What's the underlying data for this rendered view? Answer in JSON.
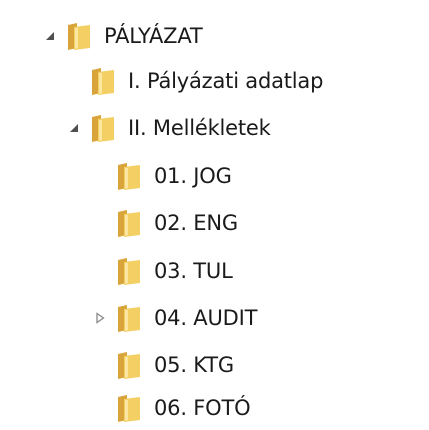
{
  "tree": {
    "items": [
      {
        "label": "PÁLYÁZAT",
        "state": "expanded"
      },
      {
        "label": "I. Pályázati adatlap",
        "state": "leaf"
      },
      {
        "label": "II. Mellékletek",
        "state": "expanded"
      },
      {
        "label": "01. JOG",
        "state": "leaf"
      },
      {
        "label": "02. ENG",
        "state": "leaf"
      },
      {
        "label": "03. TUL",
        "state": "leaf"
      },
      {
        "label": "04. AUDIT",
        "state": "collapsed"
      },
      {
        "label": "05. KTG",
        "state": "leaf"
      },
      {
        "label": "06. FOTÓ",
        "state": "leaf"
      }
    ]
  },
  "icons": {
    "folder": "folder-icon",
    "expanded": "expanded-triangle-icon",
    "collapsed": "collapsed-triangle-icon"
  },
  "colors": {
    "folder_back": "#d9a43a",
    "folder_front": "#f4cf63",
    "folder_highlight": "#fbe7a2",
    "expanded_arrow": "#505050",
    "collapsed_arrow": "#8a8a8a"
  }
}
